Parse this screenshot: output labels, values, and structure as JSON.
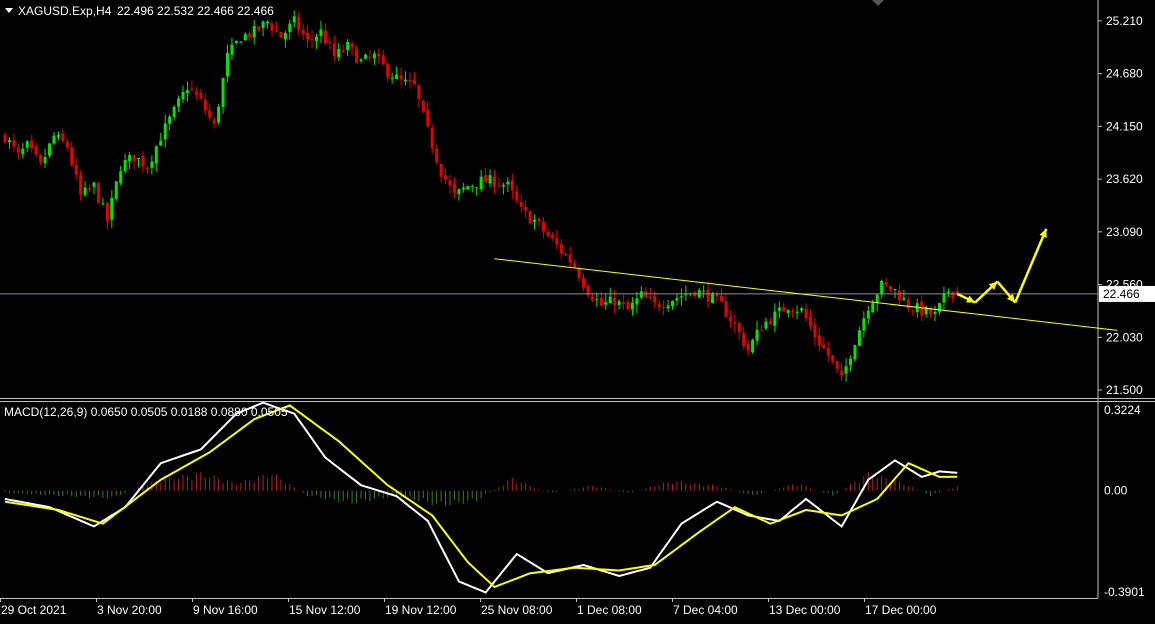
{
  "header": {
    "collapse_icon": "triangle-down-icon",
    "symbol": "XAGUSD.Exp,H4",
    "ohlc": "22.496 22.532 22.466 22.466"
  },
  "price_axis": {
    "ticks": [
      "25.210",
      "24.680",
      "24.150",
      "23.620",
      "23.090",
      "22.560",
      "22.030",
      "21.500"
    ],
    "current_price": "22.466"
  },
  "macd": {
    "label": "MACD(12,26,9) 0.0650 0.0505 0.0188 0.0880 0.0505",
    "ticks": [
      "0.3224",
      "0.00",
      "-0.3901"
    ]
  },
  "time_axis": {
    "labels": [
      "29 Oct 2021",
      "3 Nov 20:00",
      "9 Nov 16:00",
      "15 Nov 12:00",
      "19 Nov 12:00",
      "25 Nov 08:00",
      "1 Dec 08:00",
      "7 Dec 04:00",
      "13 Dec 00:00",
      "17 Dec 00:00"
    ]
  },
  "colors": {
    "background": "#000000",
    "bull": "#00e600",
    "bear": "#e60000",
    "macd_line": "#ffffff",
    "signal_line": "#ffff00",
    "trendline": "#ffff00",
    "forecast_arrows": "#ffff00",
    "grid_frame": "#c0c0c0",
    "hist_pos": "#b22222",
    "hist_neg": "#2e7d32"
  },
  "chart_data": {
    "type": "candlestick",
    "symbol": "XAGUSD.Exp",
    "timeframe": "H4",
    "y_range": [
      21.42,
      25.42
    ],
    "current_price": 22.466,
    "close_path": [
      {
        "t": 0,
        "v": 24.05
      },
      {
        "t": 3,
        "v": 23.85
      },
      {
        "t": 5,
        "v": 23.95
      },
      {
        "t": 8,
        "v": 23.75
      },
      {
        "t": 11,
        "v": 24.05
      },
      {
        "t": 14,
        "v": 23.95
      },
      {
        "t": 17,
        "v": 23.45
      },
      {
        "t": 20,
        "v": 23.55
      },
      {
        "t": 23,
        "v": 23.2
      },
      {
        "t": 26,
        "v": 23.75
      },
      {
        "t": 29,
        "v": 23.85
      },
      {
        "t": 32,
        "v": 23.75
      },
      {
        "t": 35,
        "v": 24.05
      },
      {
        "t": 38,
        "v": 24.3
      },
      {
        "t": 41,
        "v": 24.55
      },
      {
        "t": 44,
        "v": 24.4
      },
      {
        "t": 47,
        "v": 24.15
      },
      {
        "t": 50,
        "v": 24.85
      },
      {
        "t": 53,
        "v": 25.05
      },
      {
        "t": 56,
        "v": 25.1
      },
      {
        "t": 59,
        "v": 25.2
      },
      {
        "t": 62,
        "v": 25.05
      },
      {
        "t": 65,
        "v": 25.2
      },
      {
        "t": 68,
        "v": 25.0
      },
      {
        "t": 71,
        "v": 25.1
      },
      {
        "t": 74,
        "v": 24.85
      },
      {
        "t": 77,
        "v": 24.95
      },
      {
        "t": 80,
        "v": 24.8
      },
      {
        "t": 83,
        "v": 24.85
      },
      {
        "t": 86,
        "v": 24.7
      },
      {
        "t": 89,
        "v": 24.6
      },
      {
        "t": 92,
        "v": 24.55
      },
      {
        "t": 95,
        "v": 24.1
      },
      {
        "t": 98,
        "v": 23.7
      },
      {
        "t": 101,
        "v": 23.45
      },
      {
        "t": 104,
        "v": 23.55
      },
      {
        "t": 107,
        "v": 23.6
      },
      {
        "t": 110,
        "v": 23.6
      },
      {
        "t": 113,
        "v": 23.55
      },
      {
        "t": 116,
        "v": 23.3
      },
      {
        "t": 119,
        "v": 23.2
      },
      {
        "t": 122,
        "v": 23.05
      },
      {
        "t": 125,
        "v": 22.9
      },
      {
        "t": 128,
        "v": 22.75
      },
      {
        "t": 131,
        "v": 22.5
      },
      {
        "t": 134,
        "v": 22.35
      },
      {
        "t": 137,
        "v": 22.4
      },
      {
        "t": 140,
        "v": 22.3
      },
      {
        "t": 143,
        "v": 22.45
      },
      {
        "t": 146,
        "v": 22.35
      },
      {
        "t": 149,
        "v": 22.4
      },
      {
        "t": 152,
        "v": 22.45
      },
      {
        "t": 155,
        "v": 22.5
      },
      {
        "t": 158,
        "v": 22.45
      },
      {
        "t": 161,
        "v": 22.35
      },
      {
        "t": 164,
        "v": 22.15
      },
      {
        "t": 167,
        "v": 21.9
      },
      {
        "t": 170,
        "v": 22.15
      },
      {
        "t": 173,
        "v": 22.25
      },
      {
        "t": 176,
        "v": 22.35
      },
      {
        "t": 179,
        "v": 22.3
      },
      {
        "t": 182,
        "v": 22.05
      },
      {
        "t": 185,
        "v": 21.85
      },
      {
        "t": 188,
        "v": 21.6
      },
      {
        "t": 191,
        "v": 22.0
      },
      {
        "t": 194,
        "v": 22.35
      },
      {
        "t": 197,
        "v": 22.55
      },
      {
        "t": 200,
        "v": 22.5
      },
      {
        "t": 203,
        "v": 22.35
      },
      {
        "t": 206,
        "v": 22.3
      },
      {
        "t": 209,
        "v": 22.25
      },
      {
        "t": 212,
        "v": 22.5
      },
      {
        "t": 214,
        "v": 22.466
      }
    ],
    "trendline": [
      {
        "t": 110,
        "v": 22.82
      },
      {
        "t": 250,
        "v": 22.1
      }
    ],
    "forecast_path": [
      {
        "t": 214,
        "v": 22.466
      },
      {
        "t": 218,
        "v": 22.38
      },
      {
        "t": 223,
        "v": 22.59
      },
      {
        "t": 227,
        "v": 22.38
      },
      {
        "t": 234,
        "v": 23.12
      }
    ],
    "macd": {
      "y_range": [
        -0.3901,
        0.3224
      ],
      "macd_line": [
        {
          "t": 0,
          "v": -0.03
        },
        {
          "t": 10,
          "v": -0.06
        },
        {
          "t": 20,
          "v": -0.13
        },
        {
          "t": 27,
          "v": -0.06
        },
        {
          "t": 35,
          "v": 0.1
        },
        {
          "t": 44,
          "v": 0.15
        },
        {
          "t": 52,
          "v": 0.28
        },
        {
          "t": 58,
          "v": 0.32
        },
        {
          "t": 65,
          "v": 0.28
        },
        {
          "t": 72,
          "v": 0.12
        },
        {
          "t": 80,
          "v": 0.02
        },
        {
          "t": 88,
          "v": -0.02
        },
        {
          "t": 95,
          "v": -0.11
        },
        {
          "t": 102,
          "v": -0.33
        },
        {
          "t": 108,
          "v": -0.37
        },
        {
          "t": 115,
          "v": -0.23
        },
        {
          "t": 122,
          "v": -0.3
        },
        {
          "t": 130,
          "v": -0.27
        },
        {
          "t": 138,
          "v": -0.31
        },
        {
          "t": 145,
          "v": -0.28
        },
        {
          "t": 152,
          "v": -0.12
        },
        {
          "t": 160,
          "v": -0.04
        },
        {
          "t": 167,
          "v": -0.09
        },
        {
          "t": 174,
          "v": -0.11
        },
        {
          "t": 180,
          "v": -0.03
        },
        {
          "t": 188,
          "v": -0.13
        },
        {
          "t": 194,
          "v": 0.04
        },
        {
          "t": 200,
          "v": 0.11
        },
        {
          "t": 206,
          "v": 0.05
        },
        {
          "t": 210,
          "v": 0.07
        },
        {
          "t": 214,
          "v": 0.065
        }
      ],
      "signal_line": [
        {
          "t": 0,
          "v": -0.04
        },
        {
          "t": 12,
          "v": -0.07
        },
        {
          "t": 22,
          "v": -0.12
        },
        {
          "t": 35,
          "v": 0.04
        },
        {
          "t": 46,
          "v": 0.14
        },
        {
          "t": 56,
          "v": 0.26
        },
        {
          "t": 64,
          "v": 0.31
        },
        {
          "t": 75,
          "v": 0.18
        },
        {
          "t": 86,
          "v": 0.02
        },
        {
          "t": 96,
          "v": -0.09
        },
        {
          "t": 104,
          "v": -0.26
        },
        {
          "t": 110,
          "v": -0.35
        },
        {
          "t": 118,
          "v": -0.3
        },
        {
          "t": 128,
          "v": -0.28
        },
        {
          "t": 138,
          "v": -0.29
        },
        {
          "t": 146,
          "v": -0.27
        },
        {
          "t": 156,
          "v": -0.15
        },
        {
          "t": 164,
          "v": -0.06
        },
        {
          "t": 172,
          "v": -0.12
        },
        {
          "t": 180,
          "v": -0.07
        },
        {
          "t": 188,
          "v": -0.09
        },
        {
          "t": 196,
          "v": -0.03
        },
        {
          "t": 203,
          "v": 0.1
        },
        {
          "t": 210,
          "v": 0.05
        },
        {
          "t": 214,
          "v": 0.0505
        }
      ],
      "histogram_profile": [
        {
          "t": 0,
          "v": -0.01
        },
        {
          "t": 12,
          "v": -0.02
        },
        {
          "t": 24,
          "v": -0.03
        },
        {
          "t": 34,
          "v": 0.04
        },
        {
          "t": 44,
          "v": 0.07
        },
        {
          "t": 52,
          "v": 0.03
        },
        {
          "t": 60,
          "v": 0.07
        },
        {
          "t": 68,
          "v": -0.02
        },
        {
          "t": 78,
          "v": -0.05
        },
        {
          "t": 88,
          "v": -0.02
        },
        {
          "t": 98,
          "v": -0.06
        },
        {
          "t": 106,
          "v": -0.04
        },
        {
          "t": 114,
          "v": 0.05
        },
        {
          "t": 122,
          "v": -0.01
        },
        {
          "t": 132,
          "v": 0.02
        },
        {
          "t": 140,
          "v": -0.01
        },
        {
          "t": 150,
          "v": 0.04
        },
        {
          "t": 160,
          "v": 0.02
        },
        {
          "t": 168,
          "v": -0.02
        },
        {
          "t": 178,
          "v": 0.03
        },
        {
          "t": 186,
          "v": -0.02
        },
        {
          "t": 194,
          "v": 0.07
        },
        {
          "t": 202,
          "v": 0.03
        },
        {
          "t": 208,
          "v": -0.02
        },
        {
          "t": 214,
          "v": 0.0188
        }
      ]
    }
  }
}
